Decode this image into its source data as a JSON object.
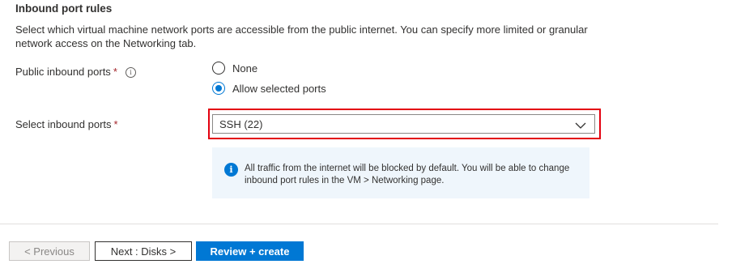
{
  "section": {
    "title": "Inbound port rules",
    "description": "Select which virtual machine network ports are accessible from the public internet. You can specify more limited or granular network access on the Networking tab."
  },
  "public_inbound_ports": {
    "label": "Public inbound ports",
    "required_mark": "*",
    "info_glyph": "i",
    "options": [
      {
        "label": "None",
        "selected": false
      },
      {
        "label": "Allow selected ports",
        "selected": true
      }
    ]
  },
  "select_inbound_ports": {
    "label": "Select inbound ports",
    "required_mark": "*",
    "value": "SSH (22)"
  },
  "info_box": {
    "icon_glyph": "i",
    "text": "All traffic from the internet will be blocked by default. You will be able to change inbound port rules in the VM > Networking page."
  },
  "footer": {
    "previous_label": "< Previous",
    "next_label": "Next : Disks >",
    "review_label": "Review + create"
  },
  "colors": {
    "accent": "#0078d4",
    "highlight_border": "#e3000f",
    "required": "#a4262c",
    "info_background": "#eff6fc"
  },
  "icons": {
    "info": "info-icon",
    "dropdown_chevron": "chevron-down-icon",
    "info_box_icon": "info-circle-icon"
  }
}
